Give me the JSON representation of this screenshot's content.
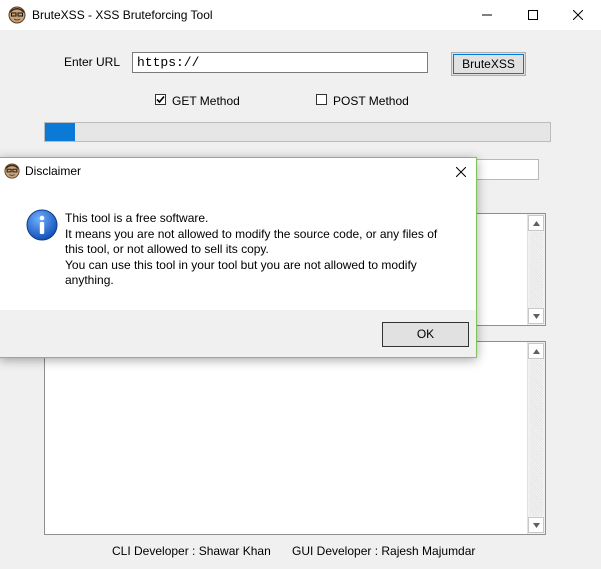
{
  "main_window": {
    "title": "BruteXSS - XSS Bruteforcing Tool",
    "url_label": "Enter URL",
    "url_value": "https://",
    "brute_button": "BruteXSS",
    "get_method": {
      "label": "GET Method",
      "checked": true
    },
    "post_method": {
      "label": "POST Method",
      "checked": false
    },
    "progress_fraction": 0.06,
    "cli_credit": "CLI Developer : Shawar Khan",
    "gui_credit": "GUI Developer : Rajesh Majumdar"
  },
  "dialog": {
    "title": "Disclaimer",
    "icon": "info-icon",
    "message_lines": [
      "This tool is a free software.",
      "It means you are not allowed to modify the source code, or any files of",
      "this tool, or not allowed to sell its copy.",
      "You can use this tool in your tool but you are not allowed to modify",
      "anything."
    ],
    "ok_button": "OK"
  },
  "colors": {
    "accent": "#0078d7",
    "progress": "#0b7ad6",
    "dialog_border": "#7fc15b"
  }
}
